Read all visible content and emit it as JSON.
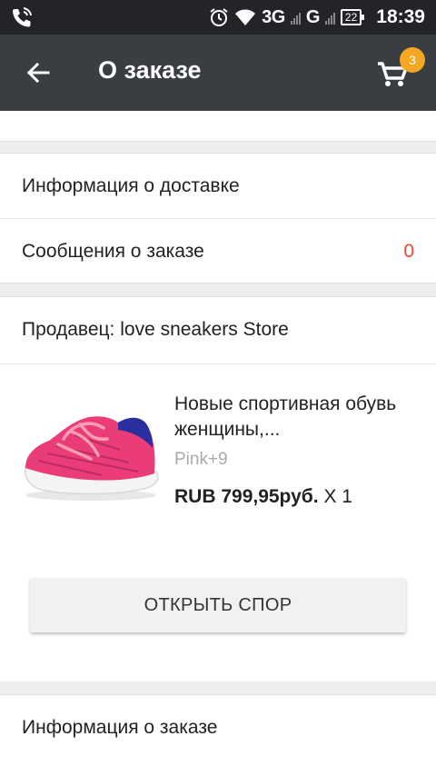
{
  "status_bar": {
    "network_1": "3G",
    "network_2": "G",
    "battery": "22",
    "time": "18:39"
  },
  "app_bar": {
    "title": "О заказе",
    "cart_count": "3"
  },
  "delivery_info": {
    "label": "Информация о доставке"
  },
  "order_messages": {
    "label": "Сообщения о заказе",
    "count": "0"
  },
  "seller": {
    "label": "Продавец: love sneakers Store"
  },
  "product": {
    "title": "Новые спортивная обувь женщины,...",
    "variant": "Pink+9",
    "price": "RUB 799,95руб.",
    "quantity": "X 1"
  },
  "dispute_button": {
    "label": "ОТКРЫТЬ СПОР"
  },
  "order_info": {
    "label": "Информация о заказе"
  },
  "colors": {
    "app_bar": "#3a3d42",
    "status_bar": "#222428",
    "badge": "#f5a623",
    "accent_red": "#f44336"
  }
}
